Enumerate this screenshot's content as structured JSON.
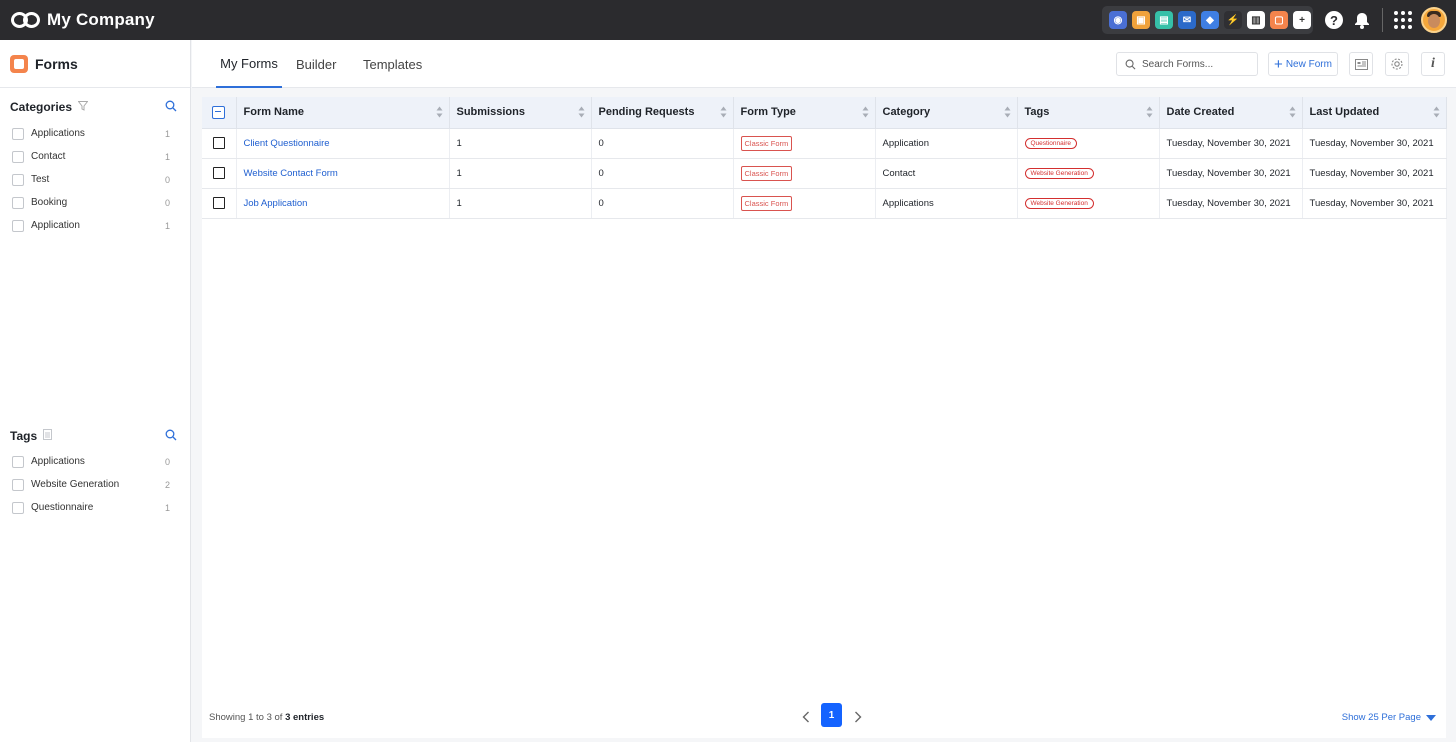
{
  "app": {
    "brand": "My Company",
    "help_icon": "?",
    "apps": [
      {
        "name": "chrome-app-icon",
        "color": "#4a6fd4",
        "glyph": "◉"
      },
      {
        "name": "orange-app-icon",
        "color": "#f0a23b",
        "glyph": "▣"
      },
      {
        "name": "teal-app-icon",
        "color": "#36c0a8",
        "glyph": "▤"
      },
      {
        "name": "mail-app-icon",
        "color": "#2b6ac9",
        "glyph": "✉"
      },
      {
        "name": "cube-app-icon",
        "color": "#3f7fe3",
        "glyph": "◆"
      },
      {
        "name": "lightning-app-icon",
        "color": "#2f2f33",
        "glyph": "⚡"
      },
      {
        "name": "chart-app-icon",
        "color": "#ffffff",
        "glyph": "▥"
      },
      {
        "name": "form-app-icon",
        "color": "#f4844c",
        "glyph": "▢"
      },
      {
        "name": "add-app-icon",
        "color": "#ffffff",
        "glyph": "+"
      }
    ]
  },
  "sidebar": {
    "title": "Forms",
    "categories_title": "Categories",
    "categories": [
      {
        "label": "Applications",
        "count": "1"
      },
      {
        "label": "Contact",
        "count": "1"
      },
      {
        "label": "Test",
        "count": "0"
      },
      {
        "label": "Booking",
        "count": "0"
      },
      {
        "label": "Application",
        "count": "1"
      }
    ],
    "tags_title": "Tags",
    "tags": [
      {
        "label": "Applications",
        "count": "0"
      },
      {
        "label": "Website Generation",
        "count": "2"
      },
      {
        "label": "Questionnaire",
        "count": "1"
      }
    ]
  },
  "tabs": [
    {
      "label": "My Forms",
      "active": true
    },
    {
      "label": "Builder",
      "active": false
    },
    {
      "label": "Templates",
      "active": false
    }
  ],
  "toolbar": {
    "search_placeholder": "Search Forms...",
    "new_form_label": "New Form",
    "info_label": "i"
  },
  "table": {
    "columns": [
      "Form Name",
      "Submissions",
      "Pending Requests",
      "Form Type",
      "Category",
      "Tags",
      "Date Created",
      "Last Updated"
    ],
    "rows": [
      {
        "name": "Client Questionnaire",
        "submissions": "1",
        "pending": "0",
        "type": "Classic Form",
        "category": "Application",
        "tag": "Questionnaire",
        "created": "Tuesday, November 30, 2021",
        "updated": "Tuesday, November 30, 2021"
      },
      {
        "name": "Website Contact Form",
        "submissions": "1",
        "pending": "0",
        "type": "Classic Form",
        "category": "Contact",
        "tag": "Website Generation",
        "created": "Tuesday, November 30, 2021",
        "updated": "Tuesday, November 30, 2021"
      },
      {
        "name": "Job Application",
        "submissions": "1",
        "pending": "0",
        "type": "Classic Form",
        "category": "Applications",
        "tag": "Website Generation",
        "created": "Tuesday, November 30, 2021",
        "updated": "Tuesday, November 30, 2021"
      }
    ]
  },
  "footer": {
    "showing_prefix": "Showing 1 to 3 of",
    "showing_entries": "3 entries",
    "current_page": "1",
    "per_page": "Show 25 Per Page"
  },
  "colors": {
    "accent": "#2e6fd9",
    "badge_red": "#d32f2f",
    "topbar": "#2b2b2e"
  }
}
